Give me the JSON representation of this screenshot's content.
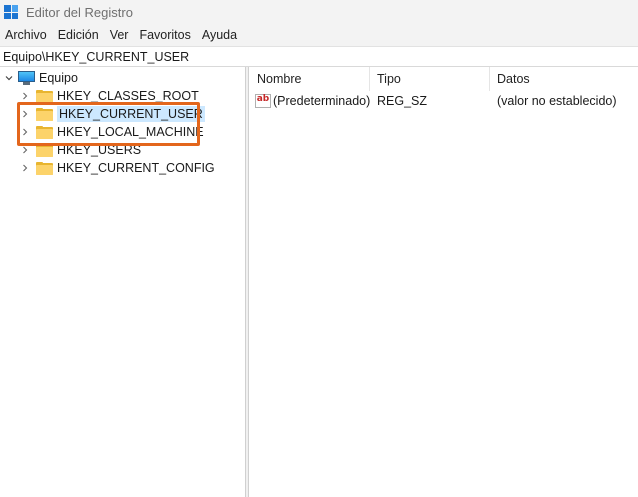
{
  "window": {
    "title": "Editor del Registro",
    "accent_color": "#1b74d1"
  },
  "menu": [
    "Archivo",
    "Edición",
    "Ver",
    "Favoritos",
    "Ayuda"
  ],
  "address": "Equipo\\HKEY_CURRENT_USER",
  "tree": {
    "root": "Equipo",
    "items": [
      {
        "label": "HKEY_CLASSES_ROOT"
      },
      {
        "label": "HKEY_CURRENT_USER",
        "selected": true
      },
      {
        "label": "HKEY_LOCAL_MACHINE"
      },
      {
        "label": "HKEY_USERS"
      },
      {
        "label": "HKEY_CURRENT_CONFIG"
      }
    ],
    "highlight_color": "#e3661c"
  },
  "list": {
    "columns": [
      "Nombre",
      "Tipo",
      "Datos"
    ],
    "rows": [
      {
        "name": "(Predeterminado)",
        "type": "REG_SZ",
        "data": "(valor no establecido)",
        "icon": "string-value-icon"
      }
    ]
  }
}
